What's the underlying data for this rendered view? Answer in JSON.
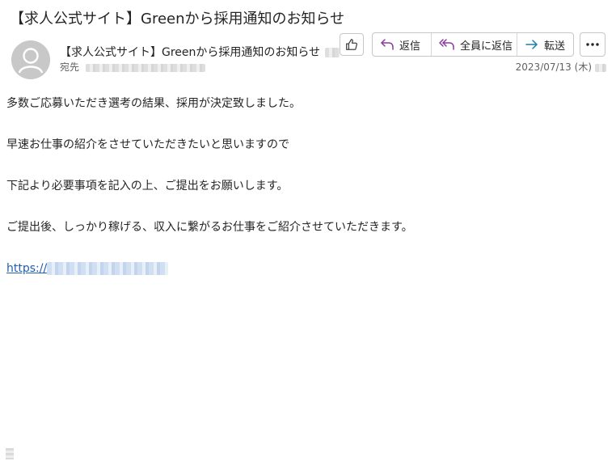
{
  "message": {
    "subject": "【求人公式サイト】Greenから採用通知のお知らせ",
    "sender_name": "【求人公式サイト】Greenから採用通知のお知らせ",
    "recipient_label": "宛先",
    "date": "2023/07/13 (木)"
  },
  "actions": {
    "like_icon": "thumbs-up-icon",
    "reply_label": "返信",
    "reply_all_label": "全員に返信",
    "forward_label": "転送",
    "more_icon": "ellipsis-icon"
  },
  "body": {
    "lines": [
      "多数ご応募いただき選考の結果、採用が決定致しました。",
      "早速お仕事の紹介をさせていただきたいと思いますので",
      "下記より必要事項を記入の上、ご提出をお願いします。",
      "ご提出後、しっかり稼げる、収入に繋がるお仕事をご紹介させていただきます。"
    ],
    "link_prefix": "https://"
  },
  "colors": {
    "accent_reply": "#8a3a9e",
    "accent_forward": "#1f7cab",
    "link": "#1f5fb0"
  }
}
